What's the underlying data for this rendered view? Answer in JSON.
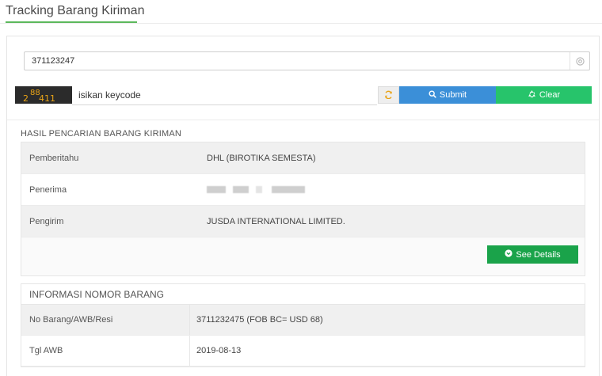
{
  "page": {
    "title": "Tracking Barang Kiriman"
  },
  "search": {
    "tracking_value": "371123247",
    "keycode_placeholder": "isikan keycode",
    "captcha_text": "2 88 411",
    "submit_label": "Submit",
    "clear_label": "Clear"
  },
  "result": {
    "heading": "HASIL PENCARIAN BARANG KIRIMAN",
    "rows": [
      {
        "label": "Pemberitahu",
        "value": "DHL (BIROTIKA SEMESTA)"
      },
      {
        "label": "Penerima",
        "value": ""
      },
      {
        "label": "Pengirim",
        "value": "JUSDA INTERNATIONAL LIMITED."
      }
    ],
    "details_label": "See Details"
  },
  "info": {
    "heading": "INFORMASI NOMOR BARANG",
    "rows": [
      {
        "label": "No Barang/AWB/Resi",
        "value": "3711232475 (FOB BC= USD 68)"
      },
      {
        "label": "Tgl AWB",
        "value": "2019-08-13"
      }
    ]
  },
  "colors": {
    "accent_green": "#5cb85c",
    "submit_blue": "#3b8fd8",
    "clear_green": "#27c46b",
    "details_green": "#1aa34a",
    "refresh_orange": "#e8a317"
  },
  "icons": {
    "submit": "search-icon",
    "clear": "recycle-icon",
    "refresh": "refresh-icon",
    "details": "chevron-circle-down-icon",
    "input_clear": "target-icon"
  }
}
